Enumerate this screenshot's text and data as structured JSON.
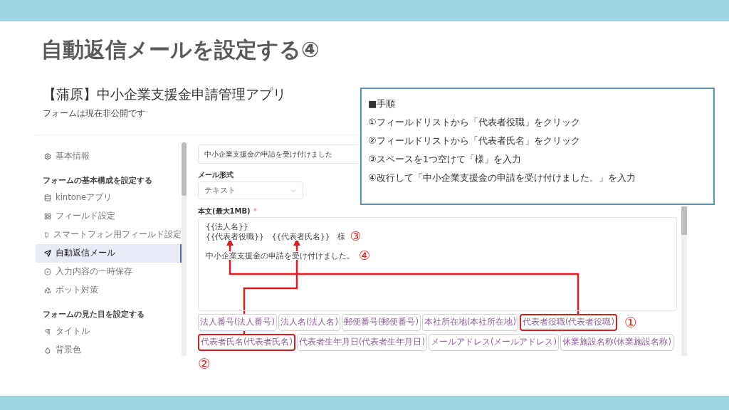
{
  "slide_title": "自動返信メールを設定する④",
  "app": {
    "title": "【蒲原】中小企業支援金申請管理アプリ",
    "status": "フォームは現在非公開です",
    "sidebar": [
      {
        "kind": "item",
        "label": "基本情報",
        "selected": false
      },
      {
        "kind": "heading",
        "label": "フォームの基本構成を設定する"
      },
      {
        "kind": "item",
        "label": "kintoneアプリ",
        "selected": false
      },
      {
        "kind": "item",
        "label": "フィールド設定",
        "selected": false
      },
      {
        "kind": "item",
        "label": "スマートフォン用フィールド設定",
        "selected": false
      },
      {
        "kind": "item",
        "label": "自動返信メール",
        "selected": true
      },
      {
        "kind": "item",
        "label": "入力内容の一時保存",
        "selected": false
      },
      {
        "kind": "item",
        "label": "ボット対策",
        "selected": false
      },
      {
        "kind": "heading",
        "label": "フォームの見た目を設定する"
      },
      {
        "kind": "item",
        "label": "タイトル",
        "selected": false
      },
      {
        "kind": "item",
        "label": "背景色",
        "selected": false
      }
    ],
    "form": {
      "subject": "中小企業支援金の申請を受け付けました",
      "format_label": "メール形式",
      "format_value": "テキスト",
      "body_label": "本文(最大1MB)",
      "required_mark": "*",
      "body_paragraphs": [
        [
          {
            "text": "{{法人名}}"
          },
          {
            "text": "{{代表者役職}}　{{代表者氏名}}　様",
            "callout": "③"
          }
        ],
        [
          {
            "text": "中小企業支援金の申請を受け付けました。",
            "callout": "④"
          }
        ]
      ],
      "field_buttons": [
        {
          "label": "法人番号(法人番号)",
          "highlighted": false
        },
        {
          "label": "法人名(法人名)",
          "highlighted": false
        },
        {
          "label": "郵便番号(郵便番号)",
          "highlighted": false
        },
        {
          "label": "本社所在地(本社所在地)",
          "highlighted": false
        },
        {
          "label": "代表者役職(代表者役職)",
          "highlighted": true,
          "callout": "①"
        },
        {
          "label": "代表者氏名(代表者氏名)",
          "highlighted": true,
          "callout": "②"
        },
        {
          "label": "代表者生年月日(代表者生年月日)",
          "highlighted": false
        },
        {
          "label": "メールアドレス(メールアドレス)",
          "highlighted": false
        },
        {
          "label": "休業施設名称(休業施設名称)",
          "highlighted": false
        }
      ]
    }
  },
  "steps": {
    "heading": "■手順",
    "items": [
      "①フィールドリストから「代表者役職」をクリック",
      "②フィールドリストから「代表者氏名」をクリック",
      "③スペースを1つ空けて「様」を入力",
      "④改行して「中小企業支援金の申請を受け付けました。」を入力"
    ]
  }
}
